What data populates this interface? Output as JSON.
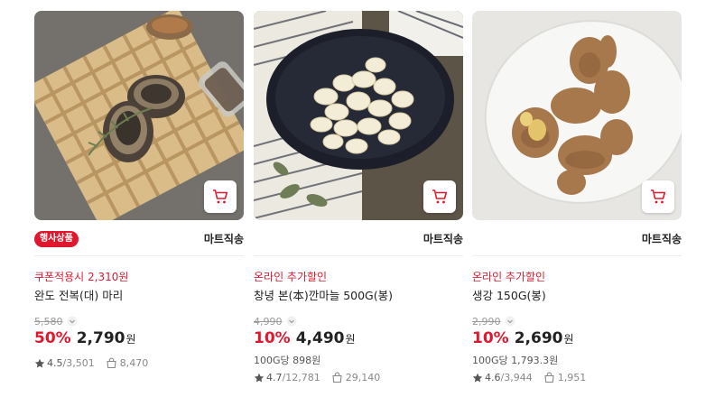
{
  "colors": {
    "accent": "#e0182d",
    "promo": "#d81e32"
  },
  "products": [
    {
      "badge": "행사상품",
      "delivery": "마트직송",
      "promo": "쿠폰적용시 2,310원",
      "name": "완도 전복(대) 마리",
      "original_price": "5,580",
      "discount": "50%",
      "price": "2,790",
      "currency": "원",
      "unit_price": "",
      "rating": "4.5",
      "reviews": "/3,501",
      "sold": "8,470"
    },
    {
      "badge": "",
      "delivery": "마트직송",
      "promo": "온라인 추가할인",
      "name": "창녕 본(本)깐마늘 500G(봉)",
      "original_price": "4,990",
      "discount": "10%",
      "price": "4,490",
      "currency": "원",
      "unit_price": "100G당 898원",
      "rating": "4.7",
      "reviews": "/12,781",
      "sold": "29,140"
    },
    {
      "badge": "",
      "delivery": "마트직송",
      "promo": "온라인 추가할인",
      "name": "생강 150G(봉)",
      "original_price": "2,990",
      "discount": "10%",
      "price": "2,690",
      "currency": "원",
      "unit_price": "100G당 1,793.3원",
      "rating": "4.6",
      "reviews": "/3,944",
      "sold": "1,951"
    }
  ],
  "icons": {
    "cart": "shopping-cart-icon",
    "chevron": "chevron-down-icon",
    "star": "star-icon",
    "bag": "shopping-bag-icon"
  }
}
